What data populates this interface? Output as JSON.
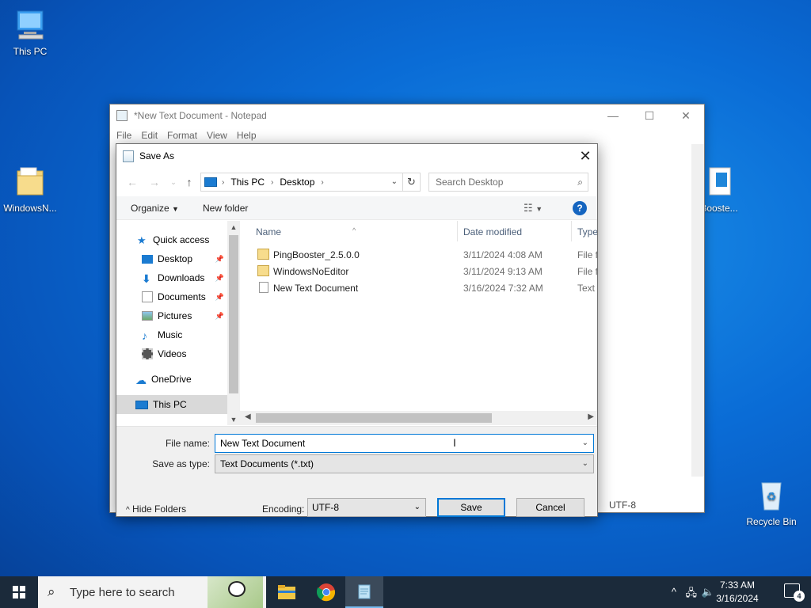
{
  "desktop": {
    "icons": [
      {
        "label": "This PC"
      },
      {
        "label": "WindowsN..."
      },
      {
        "label": "Booste..."
      },
      {
        "label": "Recycle Bin"
      }
    ]
  },
  "notepad": {
    "title": "*New Text Document - Notepad",
    "menu": [
      "File",
      "Edit",
      "Format",
      "View",
      "Help"
    ],
    "status_encoding": "UTF-8"
  },
  "dialog": {
    "title": "Save As",
    "breadcrumb": [
      "This PC",
      "Desktop"
    ],
    "search_placeholder": "Search Desktop",
    "toolbar": {
      "organize": "Organize",
      "new_folder": "New folder"
    },
    "nav": [
      {
        "label": "Quick access"
      },
      {
        "label": "Desktop"
      },
      {
        "label": "Downloads"
      },
      {
        "label": "Documents"
      },
      {
        "label": "Pictures"
      },
      {
        "label": "Music"
      },
      {
        "label": "Videos"
      },
      {
        "label": "OneDrive"
      },
      {
        "label": "This PC"
      }
    ],
    "columns": {
      "name": "Name",
      "date": "Date modified",
      "type": "Type"
    },
    "files": [
      {
        "name": "PingBooster_2.5.0.0",
        "date": "3/11/2024 4:08 AM",
        "type": "File fo"
      },
      {
        "name": "WindowsNoEditor",
        "date": "3/11/2024 9:13 AM",
        "type": "File fo"
      },
      {
        "name": "New Text Document",
        "date": "3/16/2024 7:32 AM",
        "type": "Text D"
      }
    ],
    "file_name_label": "File name:",
    "file_name_value": "New Text Document",
    "save_type_label": "Save as type:",
    "save_type_value": "Text Documents (*.txt)",
    "hide_folders": "Hide Folders",
    "encoding_label": "Encoding:",
    "encoding_value": "UTF-8",
    "save": "Save",
    "cancel": "Cancel"
  },
  "taskbar": {
    "search_placeholder": "Type here to search",
    "time": "7:33 AM",
    "date": "3/16/2024",
    "notification_count": "4"
  },
  "colors": {
    "accent": "#0078d7",
    "desktop": "#0a6cd6",
    "taskbar": "#1b2a3a"
  }
}
